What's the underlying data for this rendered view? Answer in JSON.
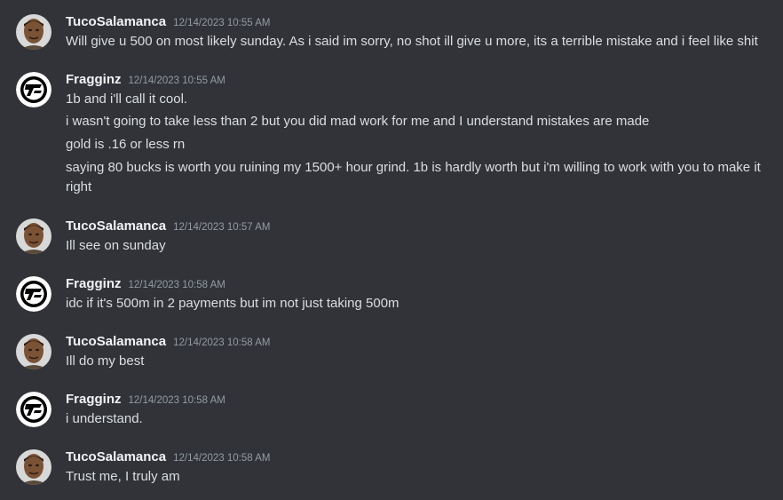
{
  "messages": [
    {
      "author": "TucoSalamanca",
      "timestamp": "12/14/2023 10:55 AM",
      "avatar": "tuco-avatar",
      "lines": [
        "Will give u 500 on most likely sunday. As i said im sorry, no shot ill give u more, its a terrible mistake and i feel like shit"
      ]
    },
    {
      "author": "Fragginz",
      "timestamp": "12/14/2023 10:55 AM",
      "avatar": "fragginz-logo-avatar",
      "lines": [
        "1b and i'll call it cool.",
        "i wasn't going to take less than 2 but you did mad work for me and I understand mistakes are made",
        "gold is .16 or less rn",
        "saying 80 bucks is worth you ruining my 1500+ hour grind. 1b is hardly worth but i'm willing to work with you to make it right"
      ]
    },
    {
      "author": "TucoSalamanca",
      "timestamp": "12/14/2023 10:57 AM",
      "avatar": "tuco-avatar",
      "lines": [
        "Ill see on sunday"
      ]
    },
    {
      "author": "Fragginz",
      "timestamp": "12/14/2023 10:58 AM",
      "avatar": "fragginz-logo-avatar",
      "lines": [
        "idc if it's 500m in 2 payments but im not just taking 500m"
      ]
    },
    {
      "author": "TucoSalamanca",
      "timestamp": "12/14/2023 10:58 AM",
      "avatar": "tuco-avatar",
      "lines": [
        "Ill do my best"
      ]
    },
    {
      "author": "Fragginz",
      "timestamp": "12/14/2023 10:58 AM",
      "avatar": "fragginz-logo-avatar",
      "lines": [
        "i understand."
      ]
    },
    {
      "author": "TucoSalamanca",
      "timestamp": "12/14/2023 10:58 AM",
      "avatar": "tuco-avatar",
      "lines": [
        "Trust me, I truly am"
      ]
    }
  ],
  "colors": {
    "background": "#313338",
    "author": "#f2f3f5",
    "text": "#dbdee1",
    "timestamp": "#949ba4"
  }
}
